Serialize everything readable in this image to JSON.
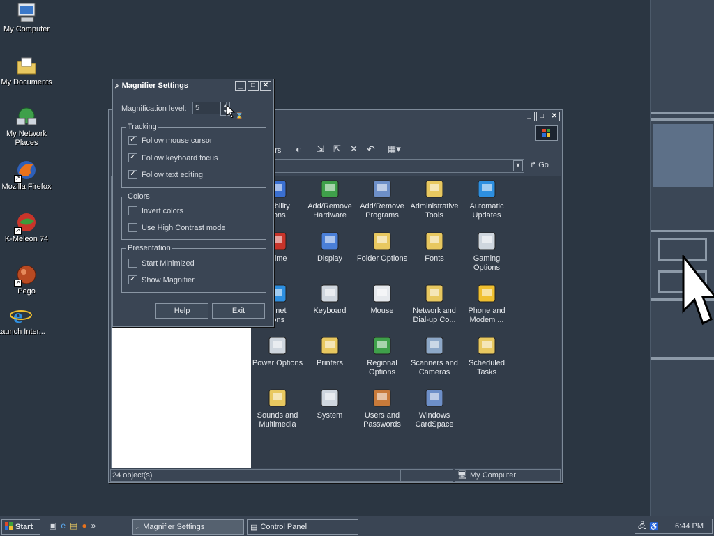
{
  "desktop": {
    "icons": [
      {
        "label": "My Computer",
        "icon": "computer-icon"
      },
      {
        "label": "My Documents",
        "icon": "folder-icon"
      },
      {
        "label": "My Network Places",
        "icon": "network-icon"
      },
      {
        "label": "Mozilla Firefox",
        "icon": "firefox-icon"
      },
      {
        "label": "K-Meleon 74",
        "icon": "kmeleon-icon"
      },
      {
        "label": "Pego",
        "icon": "pego-icon"
      },
      {
        "label": "Launch Inter...",
        "icon": "ie-icon"
      }
    ]
  },
  "magnifier": {
    "title": "Magnifier Settings",
    "level_label": "Magnification level:",
    "level_value": "5",
    "tracking": {
      "legend": "Tracking",
      "options": [
        {
          "label": "Follow mouse cursor",
          "checked": true
        },
        {
          "label": "Follow keyboard focus",
          "checked": true
        },
        {
          "label": "Follow text editing",
          "checked": true
        }
      ]
    },
    "colors": {
      "legend": "Colors",
      "options": [
        {
          "label": "Invert colors",
          "checked": false
        },
        {
          "label": "Use High Contrast mode",
          "checked": false
        }
      ]
    },
    "presentation": {
      "legend": "Presentation",
      "options": [
        {
          "label": "Start Minimized",
          "checked": false
        },
        {
          "label": "Show Magnifier",
          "checked": true
        }
      ]
    },
    "help_label": "Help",
    "exit_label": "Exit"
  },
  "control_panel": {
    "toolbar": {
      "folders_fragment": "ders",
      "go_label": "Go"
    },
    "items": [
      {
        "label": "...ssibility ...tions",
        "line1": "ssibility",
        "line2": "tions",
        "icon": "accessibility-icon"
      },
      {
        "line1": "Add/Remove",
        "line2": "Hardware",
        "icon": "hardware-icon"
      },
      {
        "line1": "Add/Remove",
        "line2": "Programs",
        "icon": "programs-icon"
      },
      {
        "line1": "Administrative",
        "line2": "Tools",
        "icon": "admin-tools-icon"
      },
      {
        "line1": "Automatic",
        "line2": "Updates",
        "icon": "updates-icon"
      },
      {
        "line1": "/Time",
        "line2": "",
        "icon": "datetime-icon"
      },
      {
        "line1": "Display",
        "line2": "",
        "icon": "display-icon"
      },
      {
        "line1": "Folder Options",
        "line2": "",
        "icon": "folder-options-icon"
      },
      {
        "line1": "Fonts",
        "line2": "",
        "icon": "fonts-icon"
      },
      {
        "line1": "Gaming",
        "line2": "Options",
        "icon": "gaming-icon"
      },
      {
        "line1": "ernet",
        "line2": "ions",
        "icon": "internet-icon"
      },
      {
        "line1": "Keyboard",
        "line2": "",
        "icon": "keyboard-icon"
      },
      {
        "line1": "Mouse",
        "line2": "",
        "icon": "mouse-icon"
      },
      {
        "line1": "Network and",
        "line2": "Dial-up Co...",
        "icon": "network-dialup-icon"
      },
      {
        "line1": "Phone and",
        "line2": "Modem ...",
        "icon": "phone-icon"
      },
      {
        "line1": "Power Options",
        "line2": "",
        "icon": "power-icon"
      },
      {
        "line1": "Printers",
        "line2": "",
        "icon": "printers-icon"
      },
      {
        "line1": "Regional",
        "line2": "Options",
        "icon": "regional-icon"
      },
      {
        "line1": "Scanners and",
        "line2": "Cameras",
        "icon": "scanner-icon"
      },
      {
        "line1": "Scheduled",
        "line2": "Tasks",
        "icon": "scheduled-icon"
      },
      {
        "line1": "Sounds and",
        "line2": "Multimedia",
        "icon": "sound-icon"
      },
      {
        "line1": "System",
        "line2": "",
        "icon": "system-icon"
      },
      {
        "line1": "Users and",
        "line2": "Passwords",
        "icon": "users-icon"
      },
      {
        "line1": "Windows",
        "line2": "CardSpace",
        "icon": "cardspace-icon"
      }
    ],
    "status": {
      "count": "24 object(s)",
      "zone": "My Computer"
    }
  },
  "taskbar": {
    "start_label": "Start",
    "tasks": [
      {
        "label": "Magnifier Settings",
        "icon": "magnifier-icon"
      },
      {
        "label": "Control Panel",
        "icon": "control-panel-icon"
      }
    ],
    "clock": "6:44 PM"
  }
}
